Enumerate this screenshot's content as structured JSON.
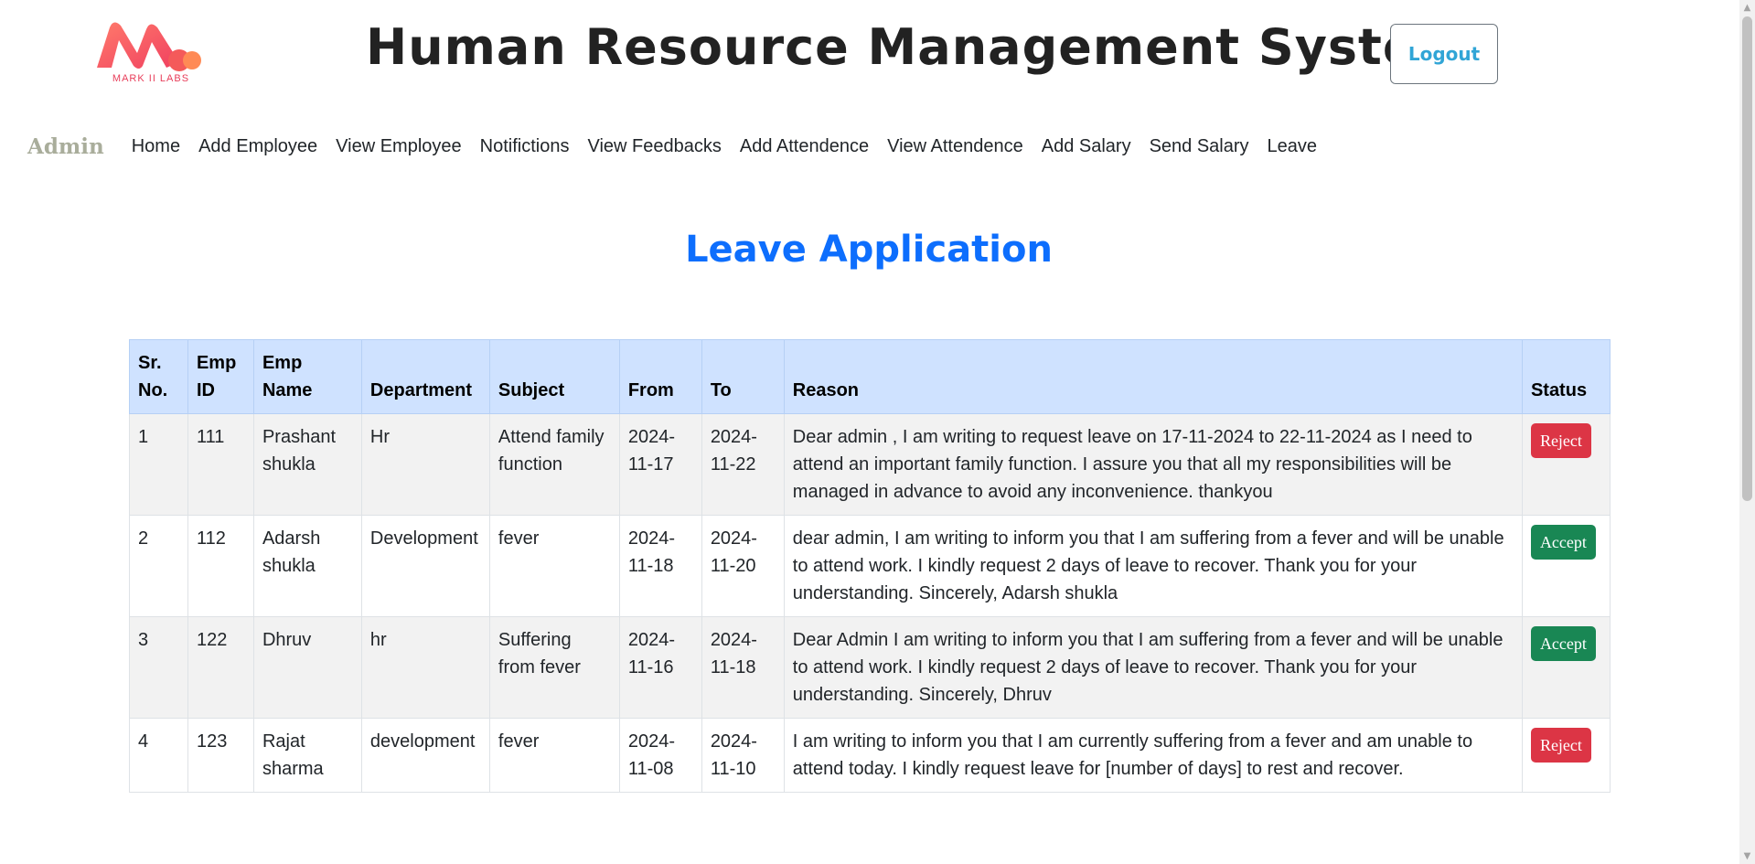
{
  "header": {
    "logo_text": "MARK II LABS",
    "title": "Human Resource Management System",
    "logout_label": "Logout"
  },
  "nav": {
    "brand": "Admin",
    "items": [
      {
        "label": "Home"
      },
      {
        "label": "Add Employee"
      },
      {
        "label": "View Employee"
      },
      {
        "label": "Notifictions"
      },
      {
        "label": "View Feedbacks"
      },
      {
        "label": "Add Attendence"
      },
      {
        "label": "View Attendence"
      },
      {
        "label": "Add Salary"
      },
      {
        "label": "Send Salary"
      },
      {
        "label": "Leave"
      }
    ]
  },
  "page": {
    "heading": "Leave Application"
  },
  "table": {
    "headers": {
      "sr_no": "Sr. No.",
      "emp_id": "Emp ID",
      "emp_name": "Emp Name",
      "department": "Department",
      "subject": "Subject",
      "from": "From",
      "to": "To",
      "reason": "Reason",
      "status": "Status"
    },
    "rows": [
      {
        "sr_no": "1",
        "emp_id": "111",
        "emp_name": "Prashant shukla",
        "department": "Hr",
        "subject": "Attend family function",
        "from": "2024-11-17",
        "to": "2024-11-22",
        "reason": "Dear admin , I am writing to request leave on 17-11-2024 to 22-11-2024 as I need to attend an important family function. I assure you that all my responsibilities will be managed in advance to avoid any inconvenience. thankyou",
        "status": "Reject"
      },
      {
        "sr_no": "2",
        "emp_id": "112",
        "emp_name": "Adarsh shukla",
        "department": "Development",
        "subject": "fever",
        "from": "2024-11-18",
        "to": "2024-11-20",
        "reason": "dear admin, I am writing to inform you that I am suffering from a fever and will be unable to attend work. I kindly request 2 days of leave to recover. Thank you for your understanding. Sincerely, Adarsh shukla",
        "status": "Accept"
      },
      {
        "sr_no": "3",
        "emp_id": "122",
        "emp_name": "Dhruv",
        "department": "hr",
        "subject": "Suffering from fever",
        "from": "2024-11-16",
        "to": "2024-11-18",
        "reason": "Dear Admin I am writing to inform you that I am suffering from a fever and will be unable to attend work. I kindly request 2 days of leave to recover. Thank you for your understanding. Sincerely, Dhruv",
        "status": "Accept"
      },
      {
        "sr_no": "4",
        "emp_id": "123",
        "emp_name": "Rajat sharma",
        "department": "development",
        "subject": "fever",
        "from": "2024-11-08",
        "to": "2024-11-10",
        "reason": "I am writing to inform you that I am currently suffering from a fever and am unable to attend today. I kindly request leave for [number of days] to rest and recover.",
        "status": "Reject"
      }
    ]
  },
  "colors": {
    "accent_blue": "#0d6efd",
    "table_header_bg": "#cfe2ff",
    "reject": "#dc3545",
    "accept": "#198754",
    "logout_text": "#31a5d6",
    "brand": "#a9ad9b"
  }
}
